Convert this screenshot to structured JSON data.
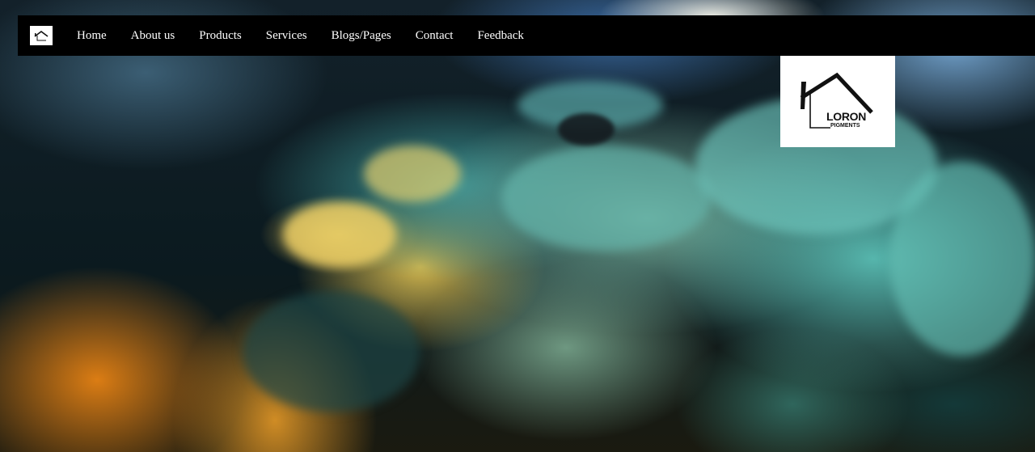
{
  "nav": {
    "logo_icon": "house-logo-icon",
    "links": [
      {
        "label": "Home"
      },
      {
        "label": "About us"
      },
      {
        "label": "Products"
      },
      {
        "label": "Services"
      },
      {
        "label": "Blogs/Pages"
      },
      {
        "label": "Contact"
      },
      {
        "label": "Feedback"
      }
    ]
  },
  "brand": {
    "name": "LORON",
    "tagline": "PIGMENTS",
    "icon": "house-roof-icon"
  },
  "hero": {
    "media": "ink-in-water-background"
  },
  "colors": {
    "nav_background": "#000000",
    "nav_text": "#ffffff",
    "brand_card": "#ffffff"
  }
}
